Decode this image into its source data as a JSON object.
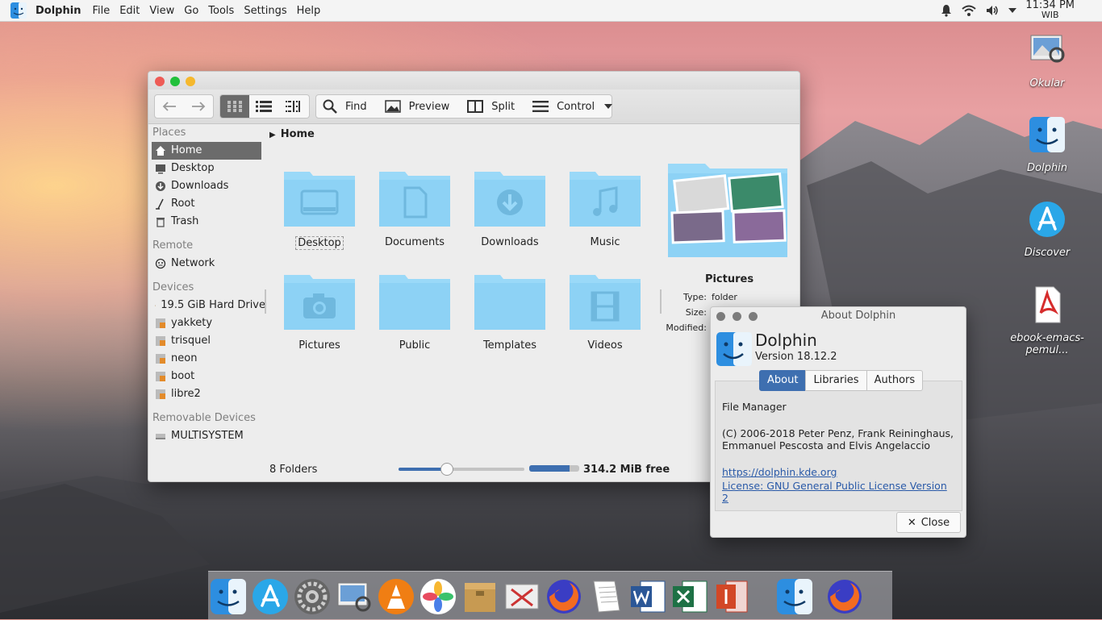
{
  "menubar": {
    "app_name": "Dolphin",
    "items": [
      "File",
      "Edit",
      "View",
      "Go",
      "Tools",
      "Settings",
      "Help"
    ],
    "clock_time": "11:34 PM",
    "clock_tz": "WIB"
  },
  "desktop_icons": [
    {
      "label": "Okular",
      "icon": "okular-icon"
    },
    {
      "label": "Dolphin",
      "icon": "dolphin-icon"
    },
    {
      "label": "Discover",
      "icon": "discover-icon"
    },
    {
      "label": "ebook-emacs-",
      "label2": "pemul...",
      "icon": "pdf-file-icon"
    }
  ],
  "toolbar": {
    "find": "Find",
    "preview": "Preview",
    "split": "Split",
    "control": "Control"
  },
  "sidebar": {
    "places_title": "Places",
    "places": [
      "Home",
      "Desktop",
      "Downloads",
      "Root",
      "Trash"
    ],
    "remote_title": "Remote",
    "remote": [
      "Network"
    ],
    "devices_title": "Devices",
    "devices": [
      "19.5 GiB Hard Drive",
      "yakkety",
      "trisquel",
      "neon",
      "boot",
      "libre2"
    ],
    "removable_title": "Removable Devices",
    "removable": [
      "MULTISYSTEM"
    ]
  },
  "breadcrumb": "Home",
  "folders": [
    "Desktop",
    "Documents",
    "Downloads",
    "Music",
    "Pictures",
    "Public",
    "Templates",
    "Videos"
  ],
  "preview": {
    "name": "Pictures",
    "type_label": "Type:",
    "type_value": "folder",
    "size_label": "Size:",
    "modified_label": "Modified:"
  },
  "status": {
    "count": "8 Folders",
    "free": "314.2 MiB free",
    "zoom_fraction": 0.38,
    "disk_fraction": 0.8
  },
  "about": {
    "title": "About Dolphin",
    "app": "Dolphin",
    "version": "Version 18.12.2",
    "tabs": [
      "About",
      "Libraries",
      "Authors"
    ],
    "desc": "File Manager",
    "copyright1": "(C) 2006-2018 Peter Penz, Frank Reininghaus,",
    "copyright2": "Emmanuel Pescosta and Elvis Angelaccio",
    "url": "https://dolphin.kde.org",
    "license": "License: GNU General Public License Version 2",
    "close": "Close"
  },
  "dock_icons": [
    "finder-icon",
    "app-store-icon",
    "system-settings-icon",
    "image-viewer-icon",
    "vlc-icon",
    "photos-icon",
    "archive-icon",
    "screenshot-icon",
    "firefox-icon",
    "text-editor-icon",
    "word-icon",
    "excel-icon",
    "impress-icon",
    "dolphin-icon",
    "firefox-icon"
  ],
  "colors": {
    "accent": "#3e6fb0",
    "folder": "#8dd2f5",
    "selection": "#6b6b6b"
  }
}
